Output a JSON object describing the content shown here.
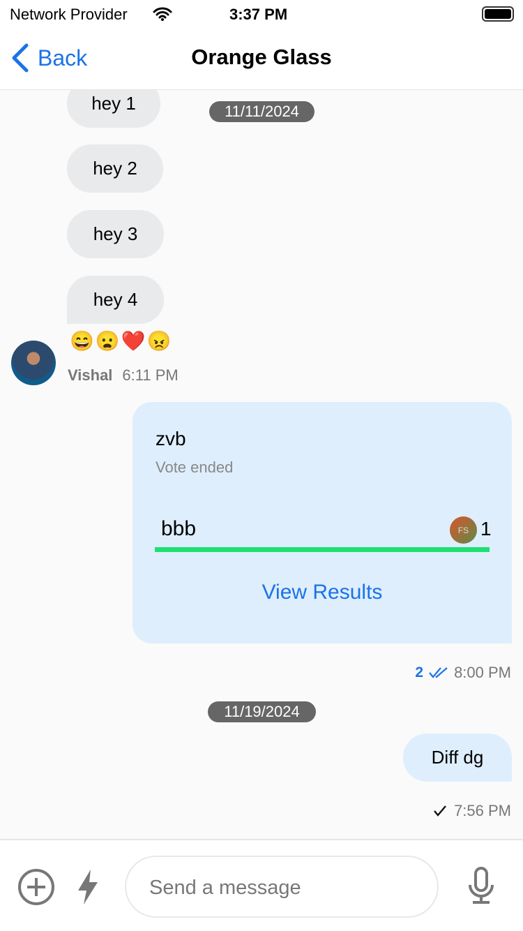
{
  "status_bar": {
    "carrier": "Network Provider",
    "time": "3:37 PM"
  },
  "nav": {
    "back_label": "Back",
    "title": "Orange Glass"
  },
  "messages_incoming": [
    {
      "text": "hey 1"
    },
    {
      "text": "hey 2"
    },
    {
      "text": "hey 3"
    },
    {
      "text": "hey 4"
    }
  ],
  "reactions": [
    "😄",
    "😦",
    "❤️",
    "😠"
  ],
  "date_separators": [
    "11/11/2024",
    "11/19/2024"
  ],
  "incoming_meta": {
    "sender": "Vishal",
    "time": "6:11 PM"
  },
  "poll": {
    "question": "zvb",
    "status": "Vote ended",
    "options": [
      {
        "text": "bbb",
        "votes": "1",
        "voter_initials": "FS",
        "fill_percent": 100
      }
    ],
    "view_results_label": "View Results",
    "read_count": "2",
    "time": "8:00 PM"
  },
  "outgoing": {
    "text": "Diff dg",
    "time": "7:56 PM"
  },
  "composer": {
    "placeholder": "Send a message"
  },
  "colors": {
    "accent": "#1a73e8",
    "outgoing_bubble": "#deeefd",
    "incoming_bubble": "#e9eaec",
    "poll_bar": "#20e070"
  }
}
